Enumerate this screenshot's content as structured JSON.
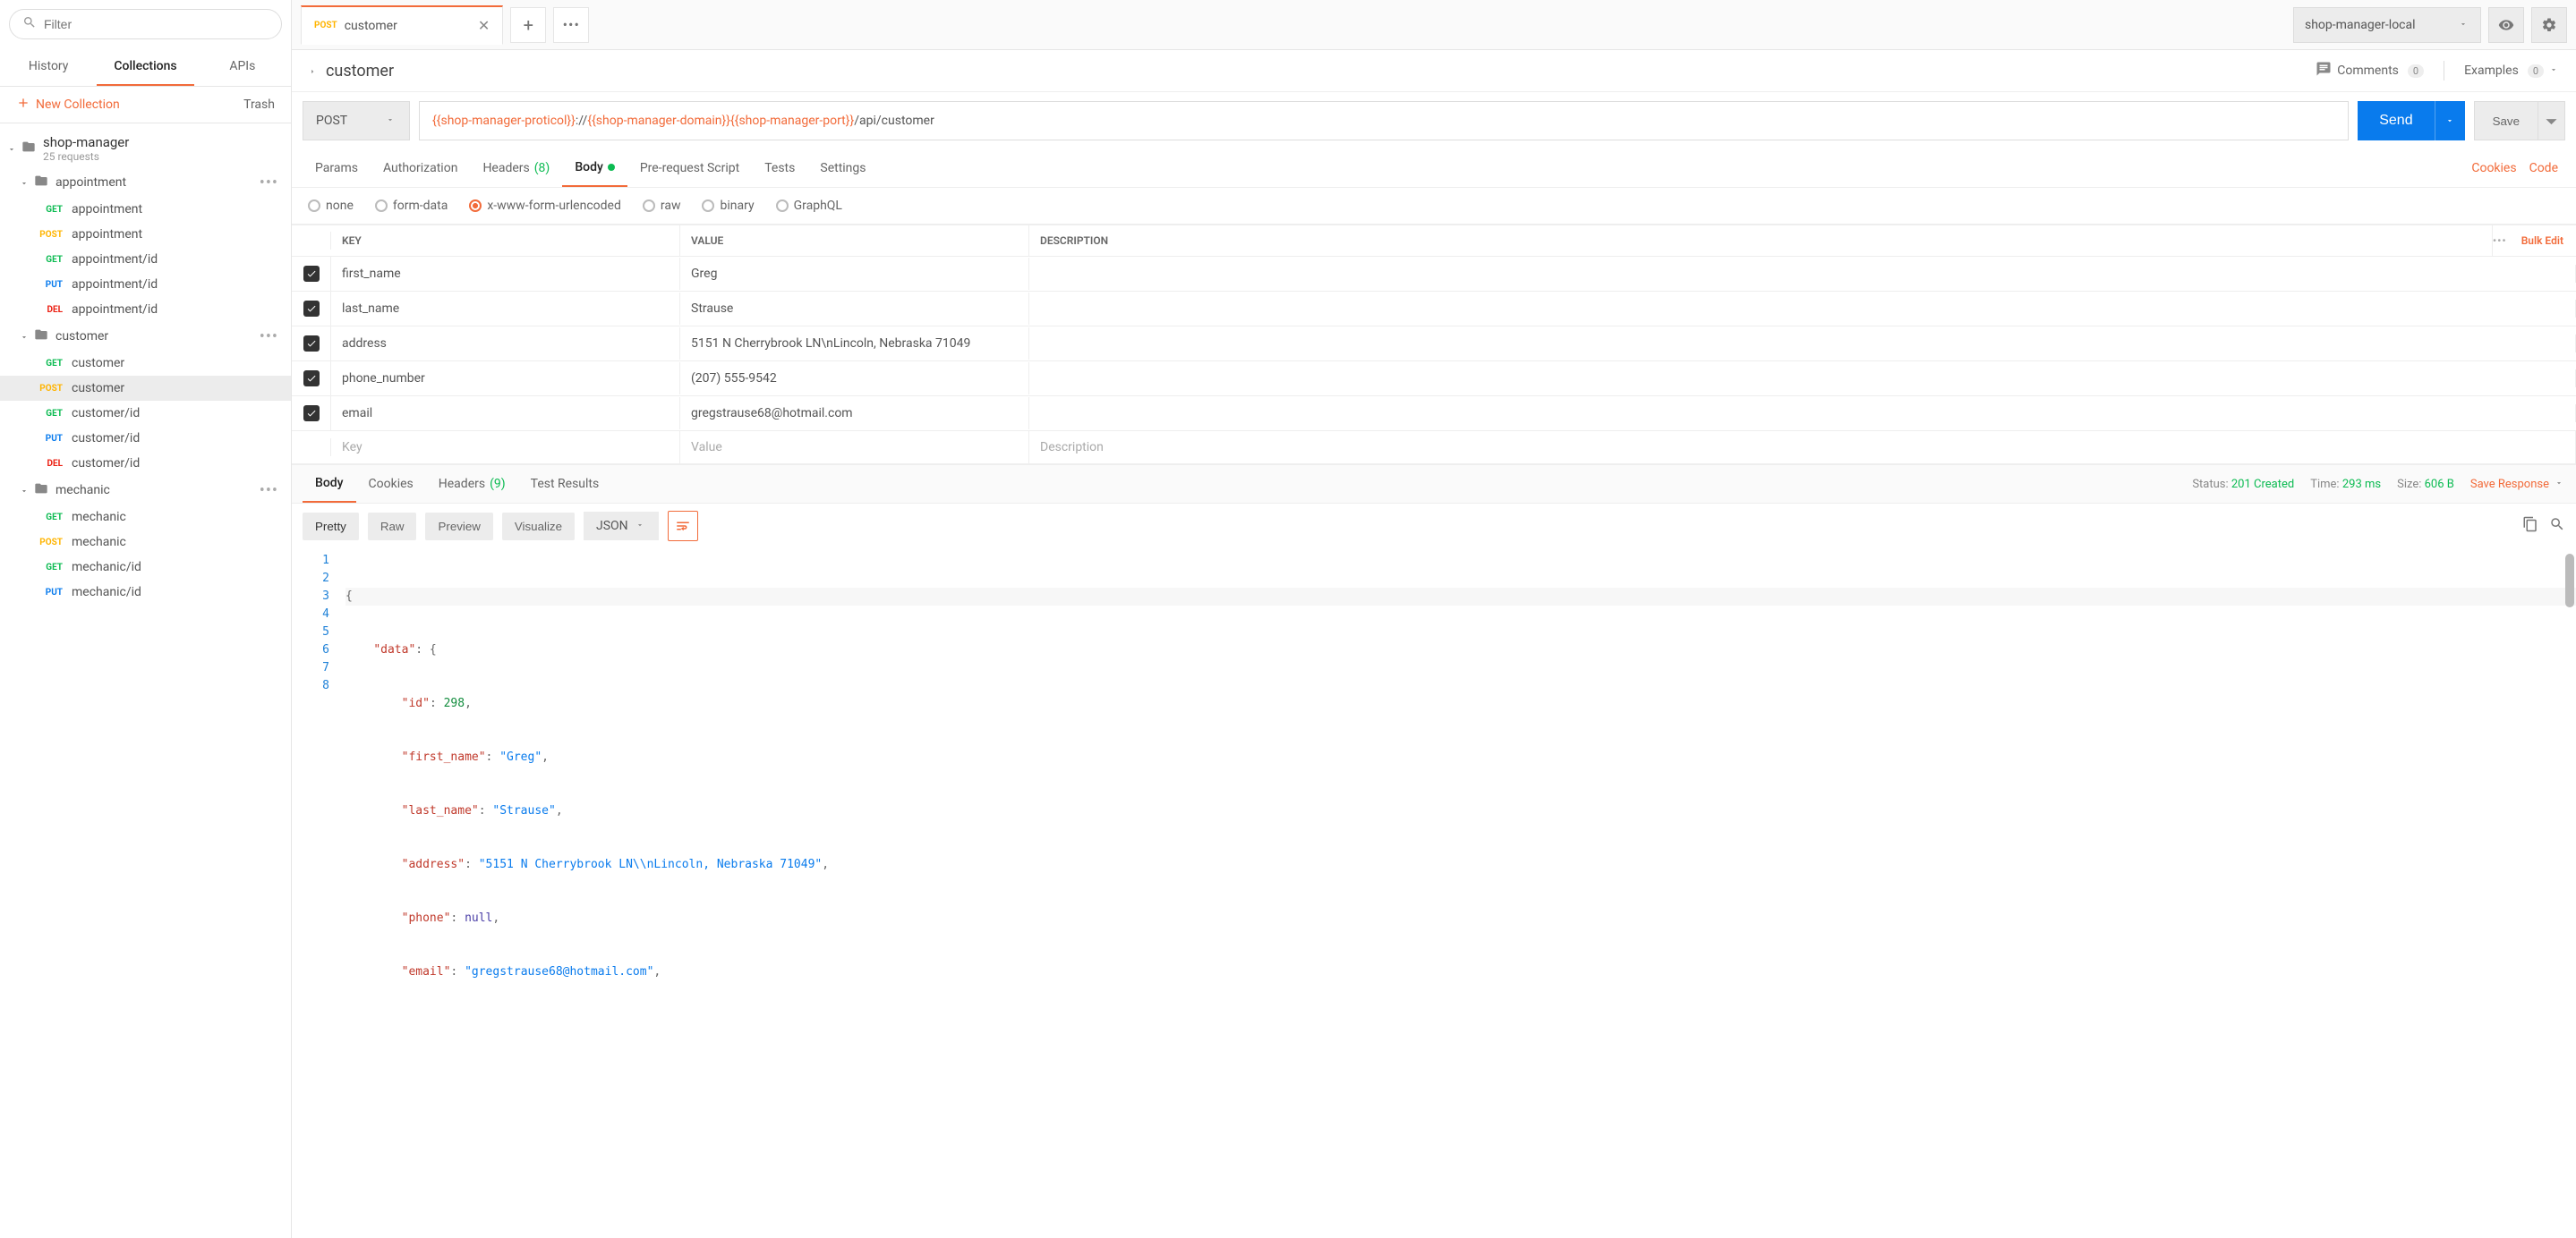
{
  "sidebar": {
    "search_placeholder": "Filter",
    "tabs": {
      "history": "History",
      "collections": "Collections",
      "apis": "APIs"
    },
    "new_collection": "New Collection",
    "trash": "Trash",
    "collection": {
      "name": "shop-manager",
      "sub": "25 requests"
    },
    "folders": [
      {
        "name": "appointment",
        "items": [
          {
            "method": "GET",
            "label": "appointment"
          },
          {
            "method": "POST",
            "label": "appointment"
          },
          {
            "method": "GET",
            "label": "appointment/id"
          },
          {
            "method": "PUT",
            "label": "appointment/id"
          },
          {
            "method": "DEL",
            "label": "appointment/id"
          }
        ]
      },
      {
        "name": "customer",
        "items": [
          {
            "method": "GET",
            "label": "customer"
          },
          {
            "method": "POST",
            "label": "customer",
            "selected": true
          },
          {
            "method": "GET",
            "label": "customer/id"
          },
          {
            "method": "PUT",
            "label": "customer/id"
          },
          {
            "method": "DEL",
            "label": "customer/id"
          }
        ]
      },
      {
        "name": "mechanic",
        "items": [
          {
            "method": "GET",
            "label": "mechanic"
          },
          {
            "method": "POST",
            "label": "mechanic"
          },
          {
            "method": "GET",
            "label": "mechanic/id"
          },
          {
            "method": "PUT",
            "label": "mechanic/id"
          }
        ]
      }
    ]
  },
  "topbar": {
    "tab_method": "POST",
    "tab_label": "customer",
    "env": "shop-manager-local"
  },
  "request": {
    "title": "customer",
    "comments": {
      "label": "Comments",
      "count": "0"
    },
    "examples": {
      "label": "Examples",
      "count": "0"
    },
    "method": "POST",
    "url_parts": {
      "v1": "{{shop-manager-proticol}}",
      "p1": "://",
      "v2": "{{shop-manager-domain}}",
      "v3": "{{shop-manager-port}}",
      "p2": "/api/customer"
    },
    "send": "Send",
    "save": "Save",
    "subtabs": {
      "params": "Params",
      "auth": "Authorization",
      "headers": "Headers",
      "headers_count": "(8)",
      "body": "Body",
      "prereq": "Pre-request Script",
      "tests": "Tests",
      "settings": "Settings",
      "cookies": "Cookies",
      "code": "Code"
    },
    "body_types": {
      "none": "none",
      "form": "form-data",
      "xwww": "x-www-form-urlencoded",
      "raw": "raw",
      "binary": "binary",
      "graphql": "GraphQL"
    },
    "kv_headers": {
      "key": "KEY",
      "value": "VALUE",
      "desc": "DESCRIPTION",
      "bulk": "Bulk Edit"
    },
    "kv_rows": [
      {
        "key": "first_name",
        "value": "Greg"
      },
      {
        "key": "last_name",
        "value": "Strause"
      },
      {
        "key": "address",
        "value": "5151 N Cherrybrook LN\\nLincoln, Nebraska 71049"
      },
      {
        "key": "phone_number",
        "value": "(207) 555-9542"
      },
      {
        "key": "email",
        "value": "gregstrause68@hotmail.com"
      }
    ],
    "kv_placeholder": {
      "key": "Key",
      "value": "Value",
      "desc": "Description"
    }
  },
  "response": {
    "tabs": {
      "body": "Body",
      "cookies": "Cookies",
      "headers": "Headers",
      "headers_count": "(9)",
      "test_results": "Test Results"
    },
    "meta": {
      "status_label": "Status:",
      "status_value": "201 Created",
      "time_label": "Time:",
      "time_value": "293 ms",
      "size_label": "Size:",
      "size_value": "606 B",
      "save": "Save Response"
    },
    "views": {
      "pretty": "Pretty",
      "raw": "Raw",
      "preview": "Preview",
      "visualize": "Visualize",
      "format": "JSON"
    },
    "json": {
      "l1": "{",
      "l2a": "\"data\"",
      "l2b": ": {",
      "l3a": "\"id\"",
      "l3b": ": ",
      "l3c": "298",
      "l3d": ",",
      "l4a": "\"first_name\"",
      "l4b": ": ",
      "l4c": "\"Greg\"",
      "l4d": ",",
      "l5a": "\"last_name\"",
      "l5b": ": ",
      "l5c": "\"Strause\"",
      "l5d": ",",
      "l6a": "\"address\"",
      "l6b": ": ",
      "l6c": "\"5151 N Cherrybrook LN\\\\nLincoln, Nebraska 71049\"",
      "l6d": ",",
      "l7a": "\"phone\"",
      "l7b": ": ",
      "l7c": "null",
      "l7d": ",",
      "l8a": "\"email\"",
      "l8b": ": ",
      "l8c": "\"gregstrause68@hotmail.com\"",
      "l8d": ","
    }
  }
}
